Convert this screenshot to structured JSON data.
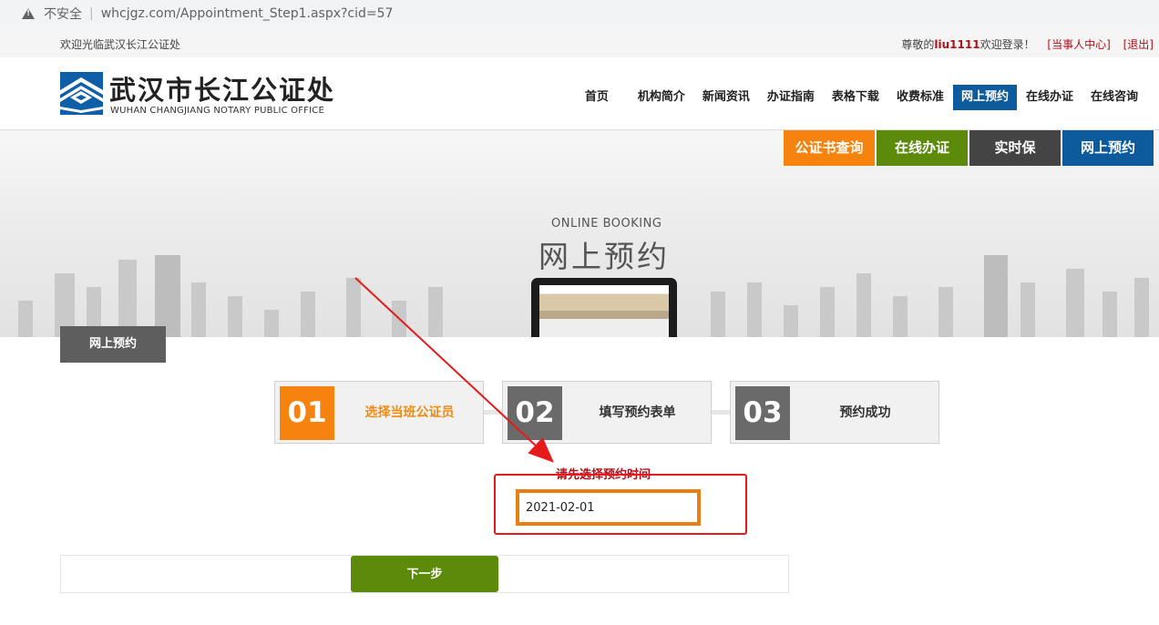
{
  "browser": {
    "security_label": "不安全",
    "url": "whcjgz.com/Appointment_Step1.aspx?cid=57"
  },
  "topbar": {
    "welcome": "欢迎光临武汉长江公证处",
    "greeting_prefix": "尊敬的",
    "username": "liu1111",
    "greeting_suffix": "欢迎登录！",
    "client_center": "[当事人中心]",
    "logout": "[退出]"
  },
  "logo": {
    "name_cn": "武汉市长江公证处",
    "name_en": "WUHAN CHANGJIANG NOTARY PUBLIC OFFICE"
  },
  "nav": {
    "items": [
      {
        "label": "首页"
      },
      {
        "label": "机构简介"
      },
      {
        "label": "新闻资讯"
      },
      {
        "label": "办证指南"
      },
      {
        "label": "表格下载"
      },
      {
        "label": "收费标准"
      },
      {
        "label": "网上预约",
        "active": true
      },
      {
        "label": "在线办证"
      },
      {
        "label": "在线咨询"
      }
    ]
  },
  "quick_buttons": [
    {
      "label": "公证书查询",
      "color": "#f7830f"
    },
    {
      "label": "在线办证",
      "color": "#5c8a0b"
    },
    {
      "label": "实时保",
      "color": "#444444"
    },
    {
      "label": "网上预约",
      "color": "#0d5a9c"
    }
  ],
  "banner": {
    "title_en": "ONLINE BOOKING",
    "title_cn": "网上预约"
  },
  "section_tab": "网上预约",
  "steps": [
    {
      "num": "01",
      "label": "选择当班公证员",
      "active": true,
      "num_color": "#f7830f"
    },
    {
      "num": "02",
      "label": "填写预约表单",
      "active": false,
      "num_color": "#6a6a6a"
    },
    {
      "num": "03",
      "label": "预约成功",
      "active": false,
      "num_color": "#6a6a6a"
    }
  ],
  "form": {
    "hint": "请先选择预约时间",
    "date_value": "2021-02-01"
  },
  "next_button": "下一步"
}
